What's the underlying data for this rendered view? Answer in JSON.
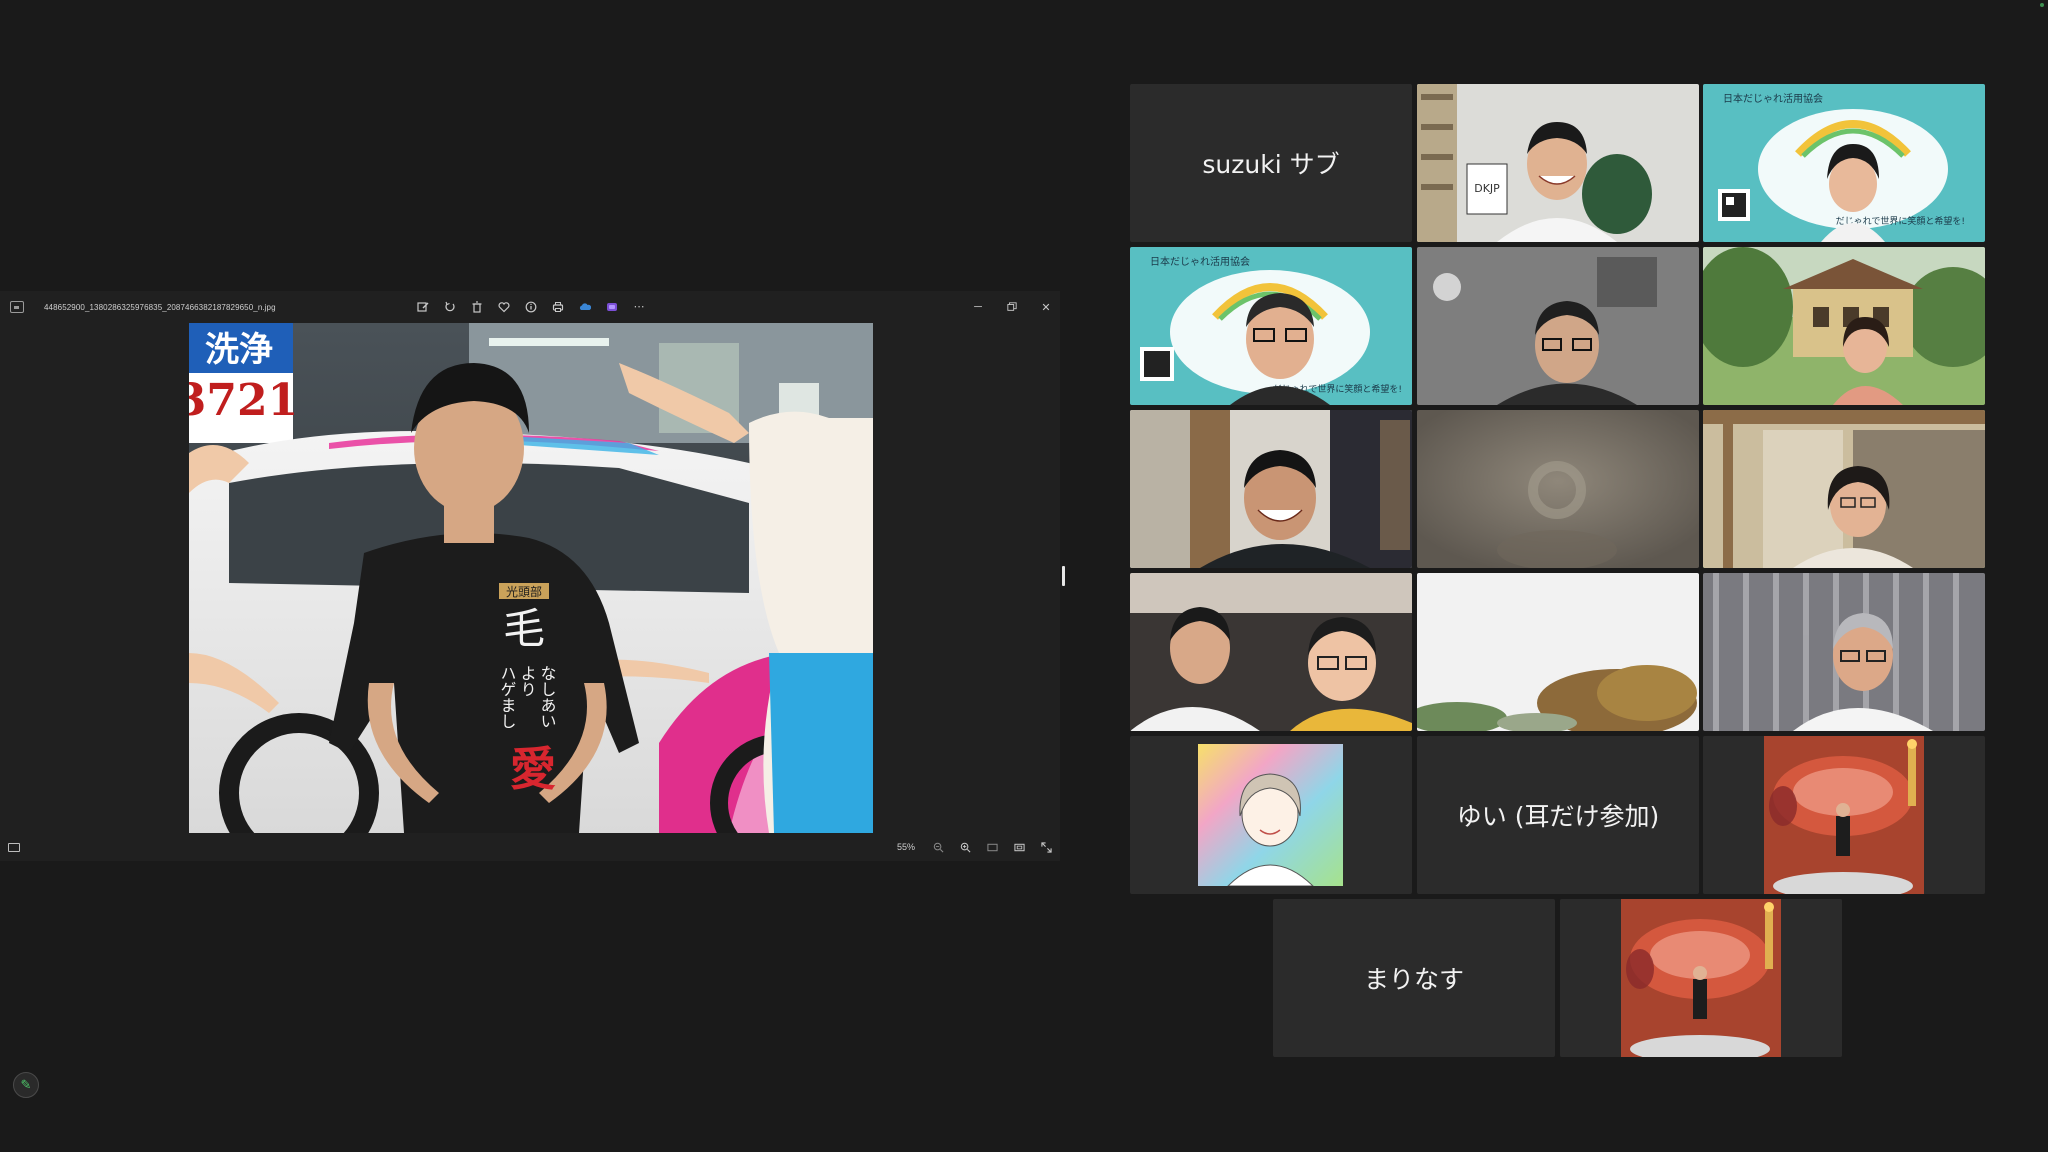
{
  "viewer": {
    "file_name": "448652900_1380286325976835_2087466382187829650_n.jpg",
    "zoom": "55%",
    "photo_text": {
      "sign_top": "洗浄",
      "sign_number": "3721",
      "shirt_label": "光頭部",
      "shirt_main": "毛",
      "shirt_col1": "なしあい",
      "shirt_col2": "より",
      "shirt_col3": "ハゲまし",
      "shirt_bottom": "愛"
    }
  },
  "participants": [
    {
      "id": "suzuki-sub",
      "name": "suzuki サブ",
      "video": false
    },
    {
      "id": "p2",
      "name": "",
      "video": true,
      "sign": "DKJP"
    },
    {
      "id": "p3",
      "name": "",
      "video": true,
      "banner": "日本だじゃれ活用協会",
      "slogan": "だじゃれで世界に笑顔と希望を!"
    },
    {
      "id": "p4",
      "name": "",
      "video": true,
      "banner": "日本だじゃれ活用協会",
      "slogan": "だじゃれで世界に笑顔と希望を!"
    },
    {
      "id": "p5",
      "name": "",
      "video": true
    },
    {
      "id": "p6",
      "name": "",
      "video": true
    },
    {
      "id": "p7",
      "name": "",
      "video": true
    },
    {
      "id": "p8",
      "name": "",
      "video": true
    },
    {
      "id": "p9",
      "name": "",
      "video": true,
      "active_speaker": true
    },
    {
      "id": "p10",
      "name": "",
      "video": true
    },
    {
      "id": "p11",
      "name": "",
      "video": true
    },
    {
      "id": "p12",
      "name": "",
      "video": true
    },
    {
      "id": "p13",
      "name": "",
      "video": true
    },
    {
      "id": "yui",
      "name": "ゆい (耳だけ参加)",
      "video": false
    },
    {
      "id": "p15",
      "name": "",
      "video": true
    },
    {
      "id": "marinasu",
      "name": "まりなす",
      "video": false
    },
    {
      "id": "p17",
      "name": "",
      "video": true
    }
  ],
  "colors": {
    "background": "#1a1a1a",
    "tile": "#2b2b2b",
    "active_speaker": "#4fc76b",
    "banner_teal": "#58bfc2"
  }
}
